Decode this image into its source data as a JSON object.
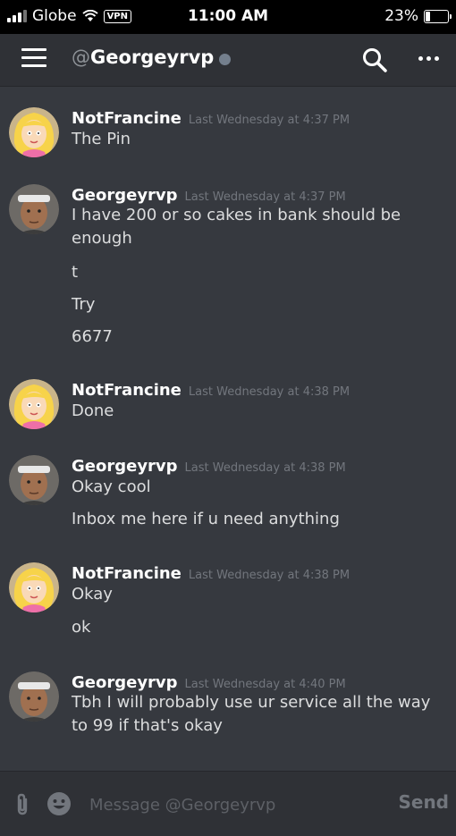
{
  "status_bar": {
    "carrier": "Globe",
    "vpn": "VPN",
    "time": "11:00 AM",
    "battery_text": "23%",
    "battery_level": 0.23
  },
  "header": {
    "at": "@",
    "username": "Georgeyrvp",
    "menu_icon": "hamburger-icon",
    "search_icon": "search-icon",
    "more_icon": "more-icon"
  },
  "messages": [
    {
      "author": "NotFrancine",
      "time": "Last Wednesday at 4:37 PM",
      "lines": [
        "The Pin"
      ]
    },
    {
      "author": "Georgeyrvp",
      "time": "Last Wednesday at 4:37 PM",
      "lines": [
        "I have 200 or so cakes in bank should be enough",
        "t",
        "Try",
        "6677"
      ]
    },
    {
      "author": "NotFrancine",
      "time": "Last Wednesday at 4:38 PM",
      "lines": [
        "Done"
      ]
    },
    {
      "author": "Georgeyrvp",
      "time": "Last Wednesday at 4:38 PM",
      "lines": [
        "Okay cool",
        "Inbox me here if u need anything"
      ]
    },
    {
      "author": "NotFrancine",
      "time": "Last Wednesday at 4:38 PM",
      "lines": [
        "Okay",
        "ok"
      ]
    },
    {
      "author": "Georgeyrvp",
      "time": "Last Wednesday at 4:40 PM",
      "lines": [
        "Tbh I will probably use ur service all the way to 99 if that's okay"
      ]
    }
  ],
  "composer": {
    "placeholder": "Message @Georgeyrvp",
    "send_label": "Send"
  },
  "colors": {
    "background": "#36393f",
    "header": "#2f3136",
    "text": "#dcddde",
    "muted": "#72767d"
  }
}
